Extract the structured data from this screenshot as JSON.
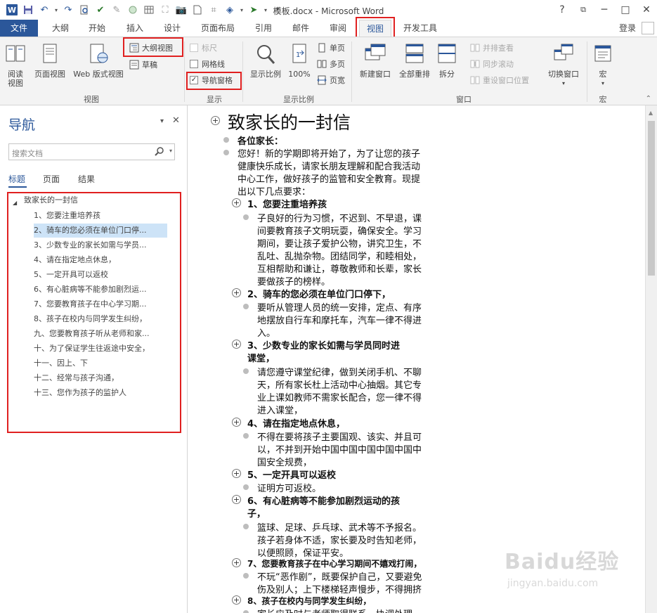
{
  "titlebar": {
    "title": "模板.docx - Microsoft Word",
    "help": "?",
    "minimize": "─",
    "restore": "□",
    "close": "✕"
  },
  "tabs": {
    "file": "文件",
    "outline": "大纲",
    "home": "开始",
    "insert": "插入",
    "design": "设计",
    "layout": "页面布局",
    "references": "引用",
    "mailings": "邮件",
    "review": "审阅",
    "view": "视图",
    "developer": "开发工具",
    "sign_in": "登录"
  },
  "ribbon": {
    "views": {
      "read_mode": "阅读视图",
      "print_layout": "页面视图",
      "web_layout": "Web 版式视图",
      "outline_view": "大纲视图",
      "draft": "草稿",
      "group_label": "视图"
    },
    "show": {
      "ruler": "标尺",
      "gridlines": "网格线",
      "nav_pane": "导航窗格",
      "nav_pane_checked": true,
      "group_label": "显示"
    },
    "zoom": {
      "zoom": "显示比例",
      "hundred": "100%",
      "one_page": "单页",
      "multi_page": "多页",
      "page_width": "页宽",
      "group_label": "显示比例"
    },
    "window": {
      "new_window": "新建窗口",
      "arrange_all": "全部重排",
      "split": "拆分",
      "side_by_side": "并排查看",
      "sync_scroll": "同步滚动",
      "reset_position": "重设窗口位置",
      "switch_windows": "切换窗口",
      "group_label": "窗口"
    },
    "macros": {
      "macros": "宏",
      "group_label": "宏"
    }
  },
  "nav": {
    "title": "导航",
    "search_placeholder": "搜索文档",
    "tabs": [
      "标题",
      "页面",
      "结果"
    ],
    "root": "致家长的一封信",
    "items": [
      "1、您要注重培养孩",
      "2、骑车的您必须在单位门口停...",
      "3、少数专业的家长如需与学员...",
      "4、请在指定地点休息，",
      "5、一定开具可以返校",
      "6、有心脏病等不能参加剧烈运...",
      "7、您要教育孩子在中心学习期...",
      "8、孩子在校内与同学发生纠纷，",
      "九、您要教育孩子听从老师和家...",
      "十、为了保证学生往返途中安全，",
      "十一、因上、下",
      "十二、经常与孩子沟通，",
      "十三、您作为孩子的监护人"
    ],
    "selected_index": 1
  },
  "doc": {
    "title": "致家长的一封信",
    "greeting": "各位家长：",
    "intro": [
      "您好！新的学期即将开始了，为了让您的孩子",
      "健康快乐成长，请家长朋友理解和配合我活动",
      "中心工作，做好孩子的监管和安全教育。现提",
      "出以下几点要求："
    ],
    "h1": "1、您要注重培养孩",
    "p1": [
      "子良好的行为习惯，不迟到、不早退，课",
      "间要教育孩子文明玩耍，确保安全。学习",
      "期间，要让孩子爱护公物，讲究卫生，不",
      "乱吐、乱抛杂物。团结同学，和睦相处，",
      "互相帮助和谦让，尊敬教师和长辈，家长",
      "要做孩子的榜样。"
    ],
    "h2": "2、骑车的您必须在单位门口停下，",
    "p2": [
      "要听从管理人员的统一安排，定点、有序",
      "地摆放自行车和摩托车，汽车一律不得进",
      "入。"
    ],
    "h3": [
      "3、少数专业的家长如需与学员同时进",
      "课堂，"
    ],
    "p3": [
      "请您遵守课堂纪律，做到关闭手机、不聊",
      "天，所有家长杜上活动中心抽烟。其它专",
      "业上课如教师不需家长配合，您一律不得",
      "进入课堂，"
    ],
    "h4": "4、请在指定地点休息，",
    "p4": [
      "不得在要将孩子主要国观、该实、并且可",
      "以，不并到开始中国中国中国中国中国中",
      "国安全规费，"
    ],
    "h5": "5、一定开具可以返校",
    "p5": [
      "证明方可返校。"
    ],
    "h6": [
      "6、有心脏病等不能参加剧烈运动的孩",
      "子，"
    ],
    "p6": [
      "篮球、足球、乒乓球、武术等不予报名。",
      "孩子若身体不适，家长要及时告知老师，",
      "以便照顾，保证平安。"
    ],
    "h7": "7、您要教育孩子在中心学习期间不嬉戏打闹，",
    "p7": [
      "不玩“恶作剧”，既要保护自己，又要避免",
      "伤及别人；上下楼梯轻声慢步，不得拥挤"
    ],
    "h8": "8、孩子在校内与同学发生纠纷，",
    "p8": [
      "家长应及时与老师取得联系，协调处理"
    ]
  },
  "watermark": {
    "brand": "Baidu经验",
    "url": "jingyan.baidu.com"
  }
}
